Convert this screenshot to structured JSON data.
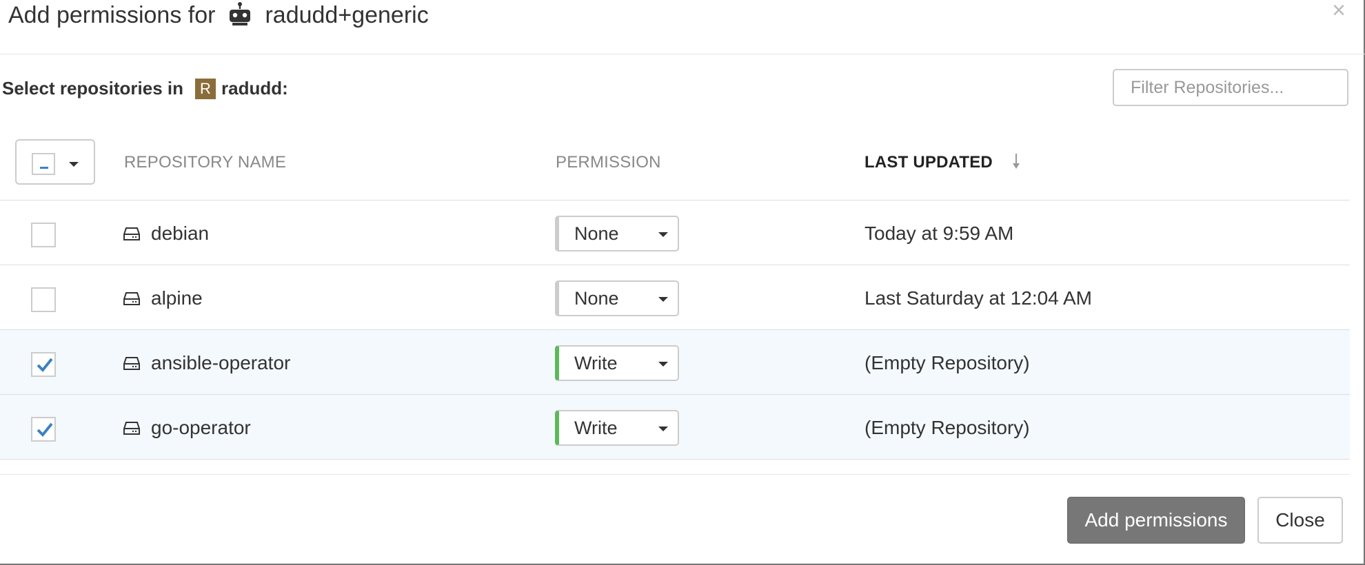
{
  "dialog": {
    "title_prefix": "Add permissions for",
    "robot_name": "radudd+generic",
    "close_glyph": "×"
  },
  "select_section": {
    "label": "Select repositories in",
    "org_initial": "R",
    "org_name": "radudd:"
  },
  "filter": {
    "placeholder": "Filter Repositories...",
    "value": ""
  },
  "table": {
    "headers": {
      "name": "REPOSITORY NAME",
      "permission": "PERMISSION",
      "last_updated": "LAST UPDATED"
    },
    "sort": {
      "column": "last_updated",
      "direction": "descending"
    },
    "rows": [
      {
        "selected": false,
        "name": "debian",
        "permission": "None",
        "last_updated": "Today at 9:59 AM"
      },
      {
        "selected": false,
        "name": "alpine",
        "permission": "None",
        "last_updated": "Last Saturday at 12:04 AM"
      },
      {
        "selected": true,
        "name": "ansible-operator",
        "permission": "Write",
        "last_updated": "(Empty Repository)"
      },
      {
        "selected": true,
        "name": "go-operator",
        "permission": "Write",
        "last_updated": "(Empty Repository)"
      }
    ]
  },
  "footer": {
    "add_label": "Add permissions",
    "close_label": "Close"
  },
  "colors": {
    "org_avatar": "#8a6d3b",
    "write_indicator": "#5cb85c",
    "none_indicator": "#cccccc",
    "checkmark": "#3b82c4",
    "selected_row_bg": "#f4f9fd",
    "primary_button": "#777777"
  },
  "icons": {
    "robot": "robot-icon",
    "repository": "repository-icon",
    "sort": "sort-descending-icon",
    "check": "checkmark-icon"
  }
}
